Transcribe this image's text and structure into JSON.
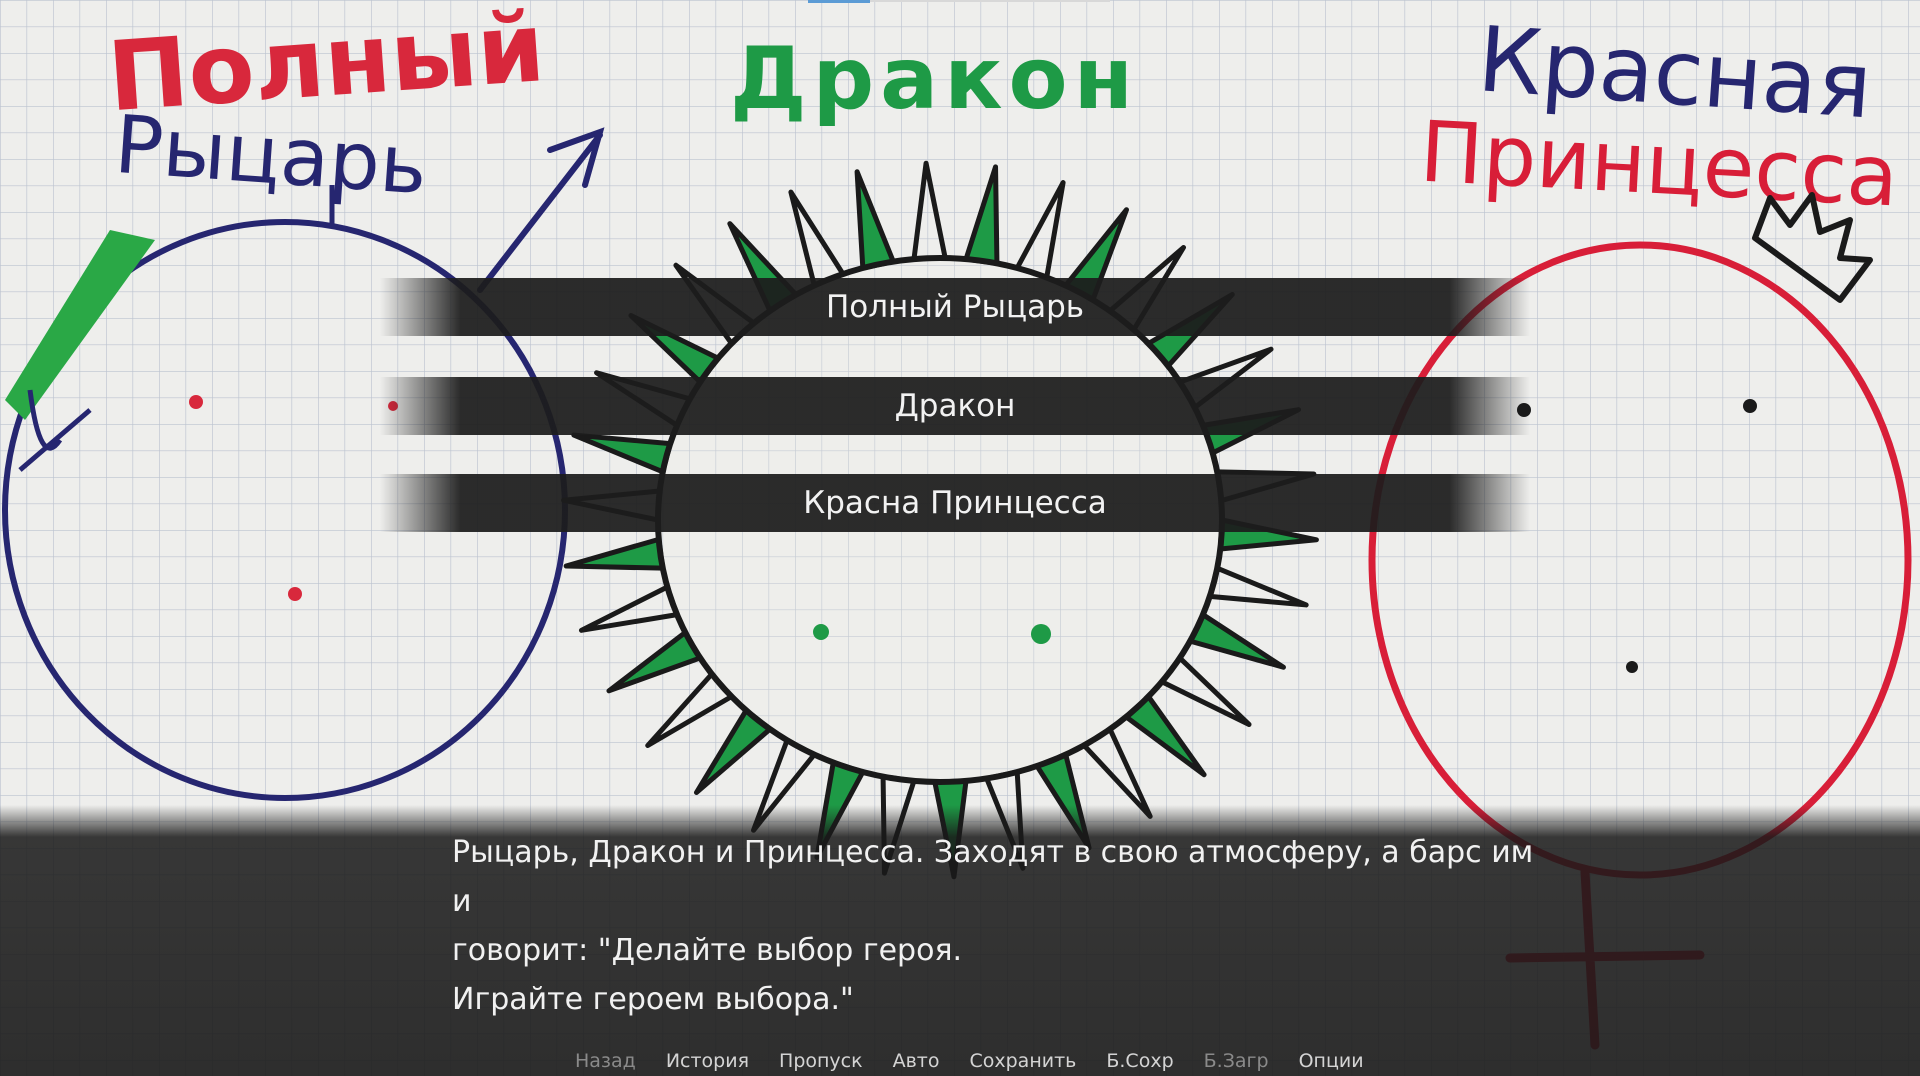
{
  "background": {
    "titles": {
      "knight_line1": "Полный",
      "knight_line2": "Рыцарь",
      "dragon": "Дракон",
      "princess_line1": "Красная",
      "princess_line2": "Принцесса"
    },
    "colors": {
      "paper": "#eeeeec",
      "grid": "#bcc3cf",
      "knight_red": "#d8283c",
      "knight_blue": "#262670",
      "dragon_green": "#1e9a46",
      "ink": "#1a1a1a",
      "princess_red": "#d81e38"
    }
  },
  "choices": [
    {
      "label": "Полный Рыцарь"
    },
    {
      "label": "Дракон"
    },
    {
      "label": "Красна Принцесса"
    }
  ],
  "dialogue": {
    "text": "Рыцарь, Дракон и Принцесса. Заходят в свою атмосферу, а барс им и\nговорит: \"Делайте выбор героя.\nИграйте героем выбора.\""
  },
  "quick_menu": [
    {
      "label": "Назад",
      "enabled": false
    },
    {
      "label": "История",
      "enabled": true
    },
    {
      "label": "Пропуск",
      "enabled": true
    },
    {
      "label": "Авто",
      "enabled": true
    },
    {
      "label": "Сохранить",
      "enabled": true
    },
    {
      "label": "Б.Сохр",
      "enabled": true
    },
    {
      "label": "Б.Загр",
      "enabled": false
    },
    {
      "label": "Опции",
      "enabled": true
    }
  ]
}
